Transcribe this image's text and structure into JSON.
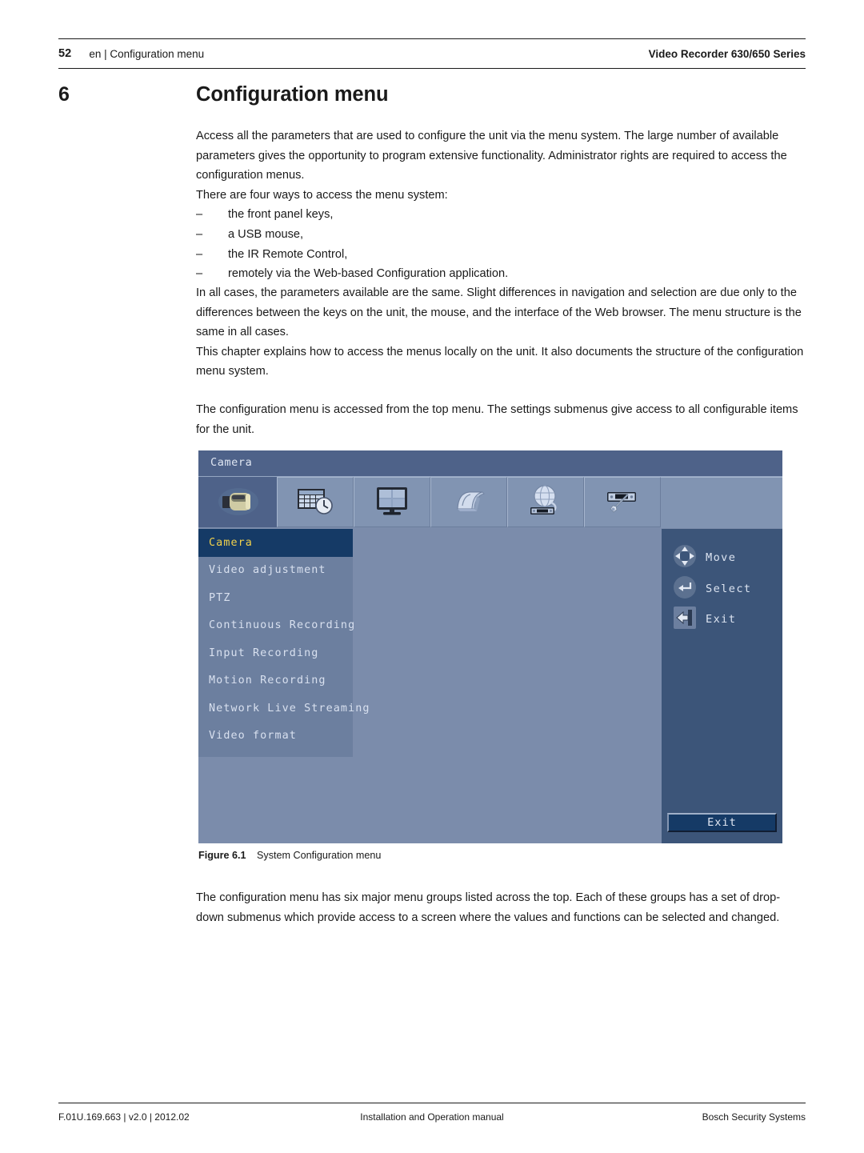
{
  "header": {
    "page_number": "52",
    "left_text": "en | Configuration menu",
    "right_text": "Video Recorder 630/650 Series"
  },
  "chapter": {
    "number": "6",
    "title": "Configuration menu"
  },
  "body": {
    "block1": {
      "paragraphs": [
        "Access all the parameters that are used to configure the unit via the menu system. The large number of available parameters gives the opportunity to program extensive functionality. Administrator rights are required to access the configuration menus.",
        "There are four ways to access the menu system:"
      ],
      "list": [
        "the front panel keys,",
        "a USB mouse,",
        "the IR Remote Control,",
        "remotely via the Web-based Configuration application."
      ],
      "dash": "–"
    },
    "block2": {
      "paragraphs": [
        "In all cases, the parameters available are the same. Slight differences in navigation and selection are due only to the differences between the keys on the unit, the mouse, and the interface of the Web browser. The menu structure is the same in all cases.",
        "This chapter explains how to access the menus locally on the unit. It also documents the structure of the configuration menu system."
      ]
    },
    "block3": {
      "paragraphs": [
        "The configuration menu is accessed from the top menu. The settings submenus give access to all configurable items for the unit."
      ]
    },
    "block4": {
      "paragraphs": [
        "The configuration menu has six major menu groups listed across the top. Each of these groups has a set of drop-down submenus which provide access to a screen where the values and functions can be selected and changed."
      ]
    }
  },
  "figure": {
    "caption_label": "Figure 6.1",
    "caption_text": "System Configuration menu",
    "osd": {
      "title": "Camera",
      "tabs": [
        {
          "icon": "camera-icon",
          "label": "Camera",
          "selected": true
        },
        {
          "icon": "schedule-clock-icon",
          "label": "Schedule",
          "selected": false
        },
        {
          "icon": "display-monitor-icon",
          "label": "Display",
          "selected": false
        },
        {
          "icon": "event-stack-icon",
          "label": "Event",
          "selected": false
        },
        {
          "icon": "network-globe-icon",
          "label": "Network",
          "selected": false
        },
        {
          "icon": "system-wrench-icon",
          "label": "System",
          "selected": false
        }
      ],
      "menu_items": [
        {
          "label": "Camera",
          "selected": true
        },
        {
          "label": "Video adjustment",
          "selected": false
        },
        {
          "label": "PTZ",
          "selected": false
        },
        {
          "label": "Continuous Recording",
          "selected": false
        },
        {
          "label": "Input Recording",
          "selected": false
        },
        {
          "label": "Motion Recording",
          "selected": false
        },
        {
          "label": "Network Live Streaming",
          "selected": false
        },
        {
          "label": "Video format",
          "selected": false
        }
      ],
      "hints": [
        {
          "icon": "dpad-move-icon",
          "label": "Move"
        },
        {
          "icon": "enter-key-icon",
          "label": "Select"
        },
        {
          "icon": "exit-door-icon",
          "label": "Exit"
        }
      ],
      "exit_button": "Exit",
      "colors": {
        "panel_bg": "#7b8cab",
        "titlebar_bg": "#4e6289",
        "menu_bg": "#6c7f9f",
        "side_bg": "#3c5579",
        "selected_bg": "#153a66",
        "selected_text": "#f2d24b",
        "text": "#d8e0ef"
      }
    }
  },
  "footer": {
    "left": "F.01U.169.663 | v2.0 | 2012.02",
    "middle": "Installation and Operation manual",
    "right": "Bosch Security Systems"
  }
}
